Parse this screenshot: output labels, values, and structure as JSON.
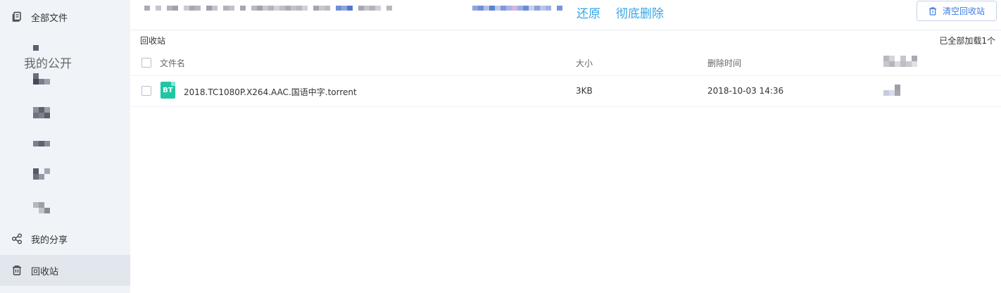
{
  "sidebar": {
    "items": [
      {
        "label": "全部文件",
        "icon": "files-icon"
      },
      {
        "label": "我的分享",
        "icon": "share-icon"
      },
      {
        "label": "回收站",
        "icon": "trash-icon"
      }
    ],
    "public_label": "我的公开"
  },
  "toolbar": {
    "restore_label": "还原",
    "delete_label": "彻底删除",
    "clear_label": "清空回收站"
  },
  "breadcrumb": "回收站",
  "load_status": "已全部加载1个",
  "table": {
    "columns": [
      "文件名",
      "大小",
      "删除时间"
    ],
    "rows": [
      {
        "type_badge": "BT",
        "name": "2018.TC1080P.X264.AAC.国语中字.torrent",
        "size": "3KB",
        "deleted_at": "2018-10-03 14:36"
      }
    ]
  },
  "colors": {
    "link": "#36a5e5",
    "button_text": "#3a7de4",
    "bt_badge": "#21c6a5",
    "sidebar_bg": "#f0f3f8"
  }
}
